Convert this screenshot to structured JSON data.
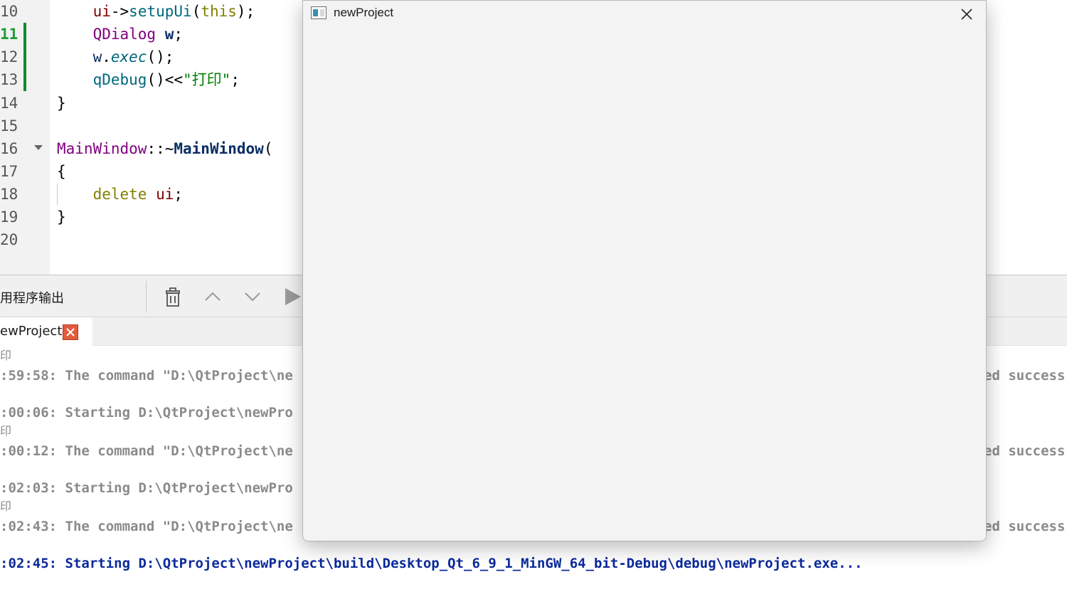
{
  "editor": {
    "line_numbers": [
      "10",
      "11",
      "12",
      "13",
      "14",
      "15",
      "16",
      "17",
      "18",
      "19",
      "20"
    ],
    "current_line": "11",
    "lines": [
      {
        "n": "10",
        "tokens": [
          {
            "t": "    "
          },
          {
            "t": "ui",
            "c": "var"
          },
          {
            "t": "->"
          },
          {
            "t": "setupUi",
            "c": "fn"
          },
          {
            "t": "("
          },
          {
            "t": "this",
            "c": "kw"
          },
          {
            "t": ");"
          }
        ]
      },
      {
        "n": "11",
        "tokens": [
          {
            "t": "    "
          },
          {
            "t": "QDialog",
            "c": "type"
          },
          {
            "t": " "
          },
          {
            "t": "w",
            "c": "bold"
          },
          {
            "t": ";"
          }
        ]
      },
      {
        "n": "12",
        "tokens": [
          {
            "t": "    "
          },
          {
            "t": "w",
            "c": "ident"
          },
          {
            "t": "."
          },
          {
            "t": "exec",
            "c": "it"
          },
          {
            "t": "();"
          }
        ]
      },
      {
        "n": "13",
        "tokens": [
          {
            "t": "    "
          },
          {
            "t": "qDebug",
            "c": "fn"
          },
          {
            "t": "()<<"
          },
          {
            "t": "\"打印\"",
            "c": "str"
          },
          {
            "t": ";"
          }
        ]
      },
      {
        "n": "14",
        "tokens": [
          {
            "t": "}"
          }
        ]
      },
      {
        "n": "15",
        "tokens": []
      },
      {
        "n": "16",
        "tokens": [
          {
            "t": "MainWindow",
            "c": "type"
          },
          {
            "t": "::~"
          },
          {
            "t": "MainWindow",
            "c": "bold"
          },
          {
            "t": "("
          }
        ]
      },
      {
        "n": "17",
        "tokens": [
          {
            "t": "{"
          }
        ]
      },
      {
        "n": "18",
        "tokens": [
          {
            "t": "    "
          },
          {
            "t": "delete",
            "c": "kw"
          },
          {
            "t": " "
          },
          {
            "t": "ui",
            "c": "var"
          },
          {
            "t": ";"
          }
        ]
      },
      {
        "n": "19",
        "tokens": [
          {
            "t": "}"
          }
        ]
      },
      {
        "n": "20",
        "tokens": []
      }
    ]
  },
  "output_pane": {
    "title": "用程序输出",
    "tab_label": "ewProject",
    "icons": {
      "clear": "trash-icon",
      "prev": "chevron-up-icon",
      "next": "chevron-down-icon",
      "run": "play-icon",
      "tab_close": "close-icon"
    }
  },
  "log": {
    "lines": [
      {
        "text": "印",
        "style": "small"
      },
      {
        "text": ":59:58: The command \"D:\\QtProject\\ne",
        "style": "gray",
        "tail": "ed success"
      },
      {
        "text": ":00:06: Starting D:\\QtProject\\newPro",
        "style": "gray"
      },
      {
        "text": "印",
        "style": "small"
      },
      {
        "text": ":00:12: The command \"D:\\QtProject\\ne",
        "style": "gray",
        "tail": "ed success"
      },
      {
        "text": ":02:03: Starting D:\\QtProject\\newPro",
        "style": "gray"
      },
      {
        "text": "印",
        "style": "small"
      },
      {
        "text": ":02:43: The command \"D:\\QtProject\\ne",
        "style": "gray",
        "tail": "ed success"
      },
      {
        "text": ":02:45: Starting D:\\QtProject\\newProject\\build\\Desktop_Qt_6_9_1_MinGW_64_bit-Debug\\debug\\newProject.exe...",
        "style": "blue"
      }
    ]
  },
  "dialog": {
    "title": "newProject",
    "icon": "app-window-icon",
    "close_icon": "close-icon"
  },
  "colors": {
    "modified_bar": "#0f8a2e",
    "log_running": "#0b2a9c",
    "tab_close_bg": "#e25b3b"
  }
}
